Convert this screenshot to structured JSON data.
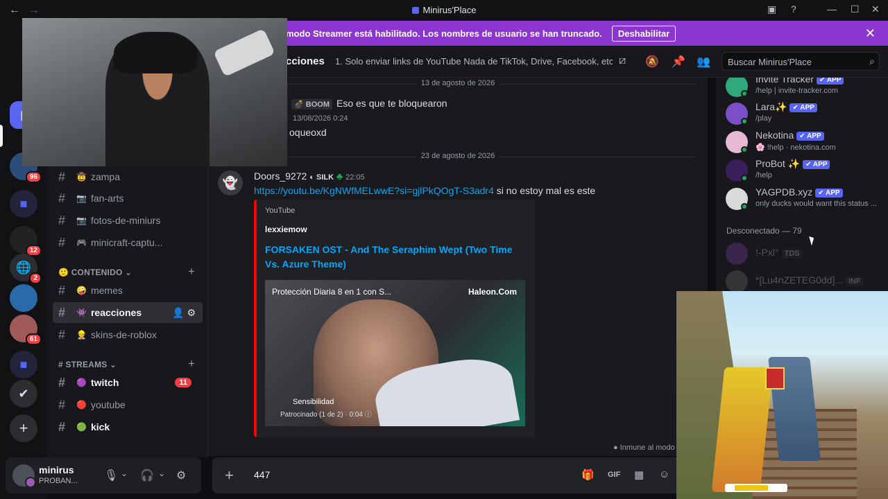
{
  "window": {
    "title": "Minirus'Place"
  },
  "banner": {
    "text": "modo Streamer está habilitado. Los nombres de usuario se han truncado.",
    "button": "Deshabilitar"
  },
  "rail": {
    "badges": [
      "96",
      "12",
      "2",
      "61"
    ]
  },
  "sidebar": {
    "channels_top": [
      {
        "name": "zampa",
        "emoji": "🤠"
      },
      {
        "name": "fan-arts",
        "emoji": "📷"
      },
      {
        "name": "fotos-de-miniurs",
        "emoji": "📷"
      },
      {
        "name": "minicraft-captu...",
        "emoji": "🎮"
      }
    ],
    "category_content": "CONTENIDO",
    "channels_content": [
      {
        "name": "memes",
        "emoji": "🤪"
      },
      {
        "name": "reacciones",
        "emoji": "👾"
      },
      {
        "name": "skins-de-roblox",
        "emoji": "👷"
      }
    ],
    "category_streams": "STREAMS",
    "channels_streams": [
      {
        "name": "twitch",
        "emoji": "🟣",
        "count": "11"
      },
      {
        "name": "youtube",
        "emoji": "🔴"
      },
      {
        "name": "kick",
        "emoji": "🟢"
      }
    ]
  },
  "user": {
    "name": "minirus",
    "status": "PROBAN..."
  },
  "header": {
    "channel": "cciones",
    "topic": "1. Solo enviar links de YouTube Nada de TikTok, Drive, Facebook, etc....",
    "search_placeholder": "Buscar Minirus'Place"
  },
  "chat": {
    "date1": "13 de agosto de 2026",
    "msg1_tag": "BOOM",
    "msg1_text": "Eso es que te bloquearon",
    "msg2_time": "13/08/2026 0:24",
    "msg2_text": "oqueoxd",
    "date2": "23 de agosto de 2026",
    "author": "Doors_9272",
    "author_tag": "SILK",
    "author_time": "22:05",
    "link": "https://youtu.be/KgNWfMELwwE?si=gjlPkQOgT-S3adr4",
    "after_link": " si no estoy mal es este",
    "embed": {
      "provider": "YouTube",
      "author": "lexxiemow",
      "title": "FORSAKEN OST - And The Seraphim Wept (Two Time Vs. Azure Theme)",
      "ad_title": "Protección Diaria 8 en 1 con S...",
      "ad_domain": "Haleon.Com",
      "ad_label": "Sensibilidad",
      "ad_meta": "Patrocinado (1 de 2) · 0:04"
    },
    "immune": "Inmune al modo"
  },
  "composer": {
    "value": "447"
  },
  "members": {
    "online": [
      {
        "name": "Invite Tracker",
        "sub": "/help | invite-tracker.com",
        "color": "#2ea97c"
      },
      {
        "name": "Lara✨",
        "sub": "/play",
        "color": "#7b4fc8"
      },
      {
        "name": "Nekotina",
        "sub": "🌸 !help · nekotina.com",
        "color": "#e6b8d4"
      },
      {
        "name": "ProBot ✨",
        "sub": "/help",
        "color": "#3b1f5c"
      },
      {
        "name": "YAGPDB.xyz",
        "sub": "only ducks would want this status ...",
        "color": "#d9d9d9"
      }
    ],
    "app_label": "APP",
    "offline_header": "Desconectado — 79",
    "offline": [
      {
        "name": "!-Pxl°",
        "tag": "TDS"
      },
      {
        "name": "*[Lu4nZETEG0dd]...",
        "tag": "INF"
      }
    ]
  }
}
